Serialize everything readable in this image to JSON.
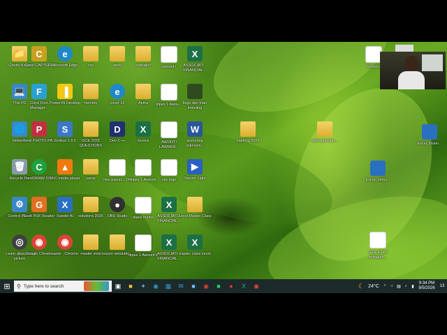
{
  "desktop": {
    "icons": [
      {
        "label": "Ghetto Kings",
        "glyph": "📁",
        "kind": "folder"
      },
      {
        "label": "Corel CAPTURE",
        "glyph": "C",
        "kind": "app",
        "color": "#c8a020"
      },
      {
        "label": "Microsoft Edge",
        "glyph": "e",
        "kind": "round",
        "color": "#1e88c8"
      },
      {
        "label": "csc",
        "glyph": "",
        "kind": "folder"
      },
      {
        "label": "work",
        "glyph": "",
        "kind": "folder"
      },
      {
        "label": "semiatch",
        "glyph": "",
        "kind": "folder"
      },
      {
        "label": "awount i",
        "glyph": "",
        "kind": "doc"
      },
      {
        "label": "ASSOCIATI... FINANCIAL...",
        "glyph": "X",
        "kind": "xl"
      },
      {
        "label": "This PC",
        "glyph": "💻",
        "kind": "app",
        "color": "#3a87c8"
      },
      {
        "label": "Corel Font Manager...",
        "glyph": "F",
        "kind": "app",
        "color": "#2aa0d0"
      },
      {
        "label": "Power BI Desktop",
        "glyph": "▐",
        "kind": "app",
        "color": "#f2c811"
      },
      {
        "label": "hemms",
        "glyph": "",
        "kind": "folder"
      },
      {
        "label": "cover 15",
        "glyph": "e",
        "kind": "round",
        "color": "#1e88c8"
      },
      {
        "label": "Apina",
        "glyph": "",
        "kind": "folder"
      },
      {
        "label": "dipes 1 Awou...",
        "glyph": "",
        "kind": "doc"
      },
      {
        "label": "llego dec man kneeling",
        "glyph": "",
        "kind": "app",
        "color": "#304a20"
      },
      {
        "label": "Network",
        "glyph": "🌐",
        "kind": "app",
        "color": "#3a87c8"
      },
      {
        "label": "Corel PHOTO-PA...",
        "glyph": "P",
        "kind": "app",
        "color": "#c03040"
      },
      {
        "label": "Scribus 1.6.5",
        "glyph": "S",
        "kind": "app",
        "color": "#3a78c8"
      },
      {
        "label": "GCE 2026 QUESTIONS",
        "glyph": "",
        "kind": "folder"
      },
      {
        "label": "Dev-C++",
        "glyph": "D",
        "kind": "app",
        "color": "#203070"
      },
      {
        "label": "invoice",
        "glyph": "X",
        "kind": "xl"
      },
      {
        "label": "AWONTI LAWREN...",
        "glyph": "",
        "kind": "doc"
      },
      {
        "label": "workshop unknown...",
        "glyph": "W",
        "kind": "wd"
      },
      {
        "label": "Recycle Bin",
        "glyph": "🗑",
        "kind": "app",
        "color": "#8a9aa8"
      },
      {
        "label": "CorelDRAW 2025",
        "glyph": "C",
        "kind": "round",
        "color": "#20a040"
      },
      {
        "label": "VLC media player",
        "glyph": "▲",
        "kind": "app",
        "color": "#f07a10"
      },
      {
        "label": "same",
        "glyph": "",
        "kind": "folder"
      },
      {
        "label": "free-paical... OK",
        "glyph": "",
        "kind": "doc"
      },
      {
        "label": "dipes 1 Awount",
        "glyph": "",
        "kind": "doc"
      },
      {
        "label": "cbc logo",
        "glyph": "",
        "kind": "doc"
      },
      {
        "label": "Televor Light",
        "glyph": "▶",
        "kind": "app",
        "color": "#2a60c0"
      },
      {
        "label": "Control Panel",
        "glyph": "⚙",
        "kind": "app",
        "color": "#3a87c8"
      },
      {
        "label": "Ecolt PDF Reader",
        "glyph": "G",
        "kind": "app",
        "color": "#e07020"
      },
      {
        "label": "Xander AI",
        "glyph": "X",
        "kind": "app",
        "color": "#2a70c0"
      },
      {
        "label": "solutions 2025",
        "glyph": "",
        "kind": "folder"
      },
      {
        "label": "OBS Studio",
        "glyph": "●",
        "kind": "round",
        "color": "#303030"
      },
      {
        "label": "dipes maths",
        "glyph": "",
        "kind": "doc"
      },
      {
        "label": "ASSOCIATI... FINANCIAL...",
        "glyph": "X",
        "kind": "xl"
      },
      {
        "label": "Excel Master Class",
        "glyph": "",
        "kind": "folder"
      },
      {
        "label": "Learn about this picture",
        "glyph": "◎",
        "kind": "round",
        "color": "#404040"
      },
      {
        "label": "Google Chrome",
        "glyph": "◉",
        "kind": "round",
        "color": "#db4437"
      },
      {
        "label": "same - Chrome",
        "glyph": "◉",
        "kind": "round",
        "color": "#db4437"
      },
      {
        "label": "master slow",
        "glyph": "",
        "kind": "folder"
      },
      {
        "label": "lesson simulatio...",
        "glyph": "",
        "kind": "folder"
      },
      {
        "label": "dipes 1 Awount if",
        "glyph": "",
        "kind": "doc"
      },
      {
        "label": "ASSOCIATI... FINANCIAL...",
        "glyph": "X",
        "kind": "xl"
      },
      {
        "label": "master class excel",
        "glyph": "X",
        "kind": "xl"
      },
      {
        "label": "marking 2026",
        "glyph": "",
        "kind": "folder"
      },
      {
        "label": "past question...",
        "glyph": "",
        "kind": "folder"
      },
      {
        "label": "Excel_Busin...",
        "glyph": "",
        "kind": "app",
        "color": "#2a70c0"
      },
      {
        "label": "Excel_Simul...",
        "glyph": "",
        "kind": "app",
        "color": "#2a70c0"
      },
      {
        "label": "GCE Exam Invitation...",
        "glyph": "",
        "kind": "doc"
      },
      {
        "label": "Screens",
        "glyph": "",
        "kind": "doc"
      }
    ]
  },
  "taskbar": {
    "start_glyph": "⊞",
    "search_placeholder": "Type here to search",
    "weather": "24°C",
    "time": "9:34 PM",
    "date": "9/5/2026",
    "notification_count": "13"
  }
}
